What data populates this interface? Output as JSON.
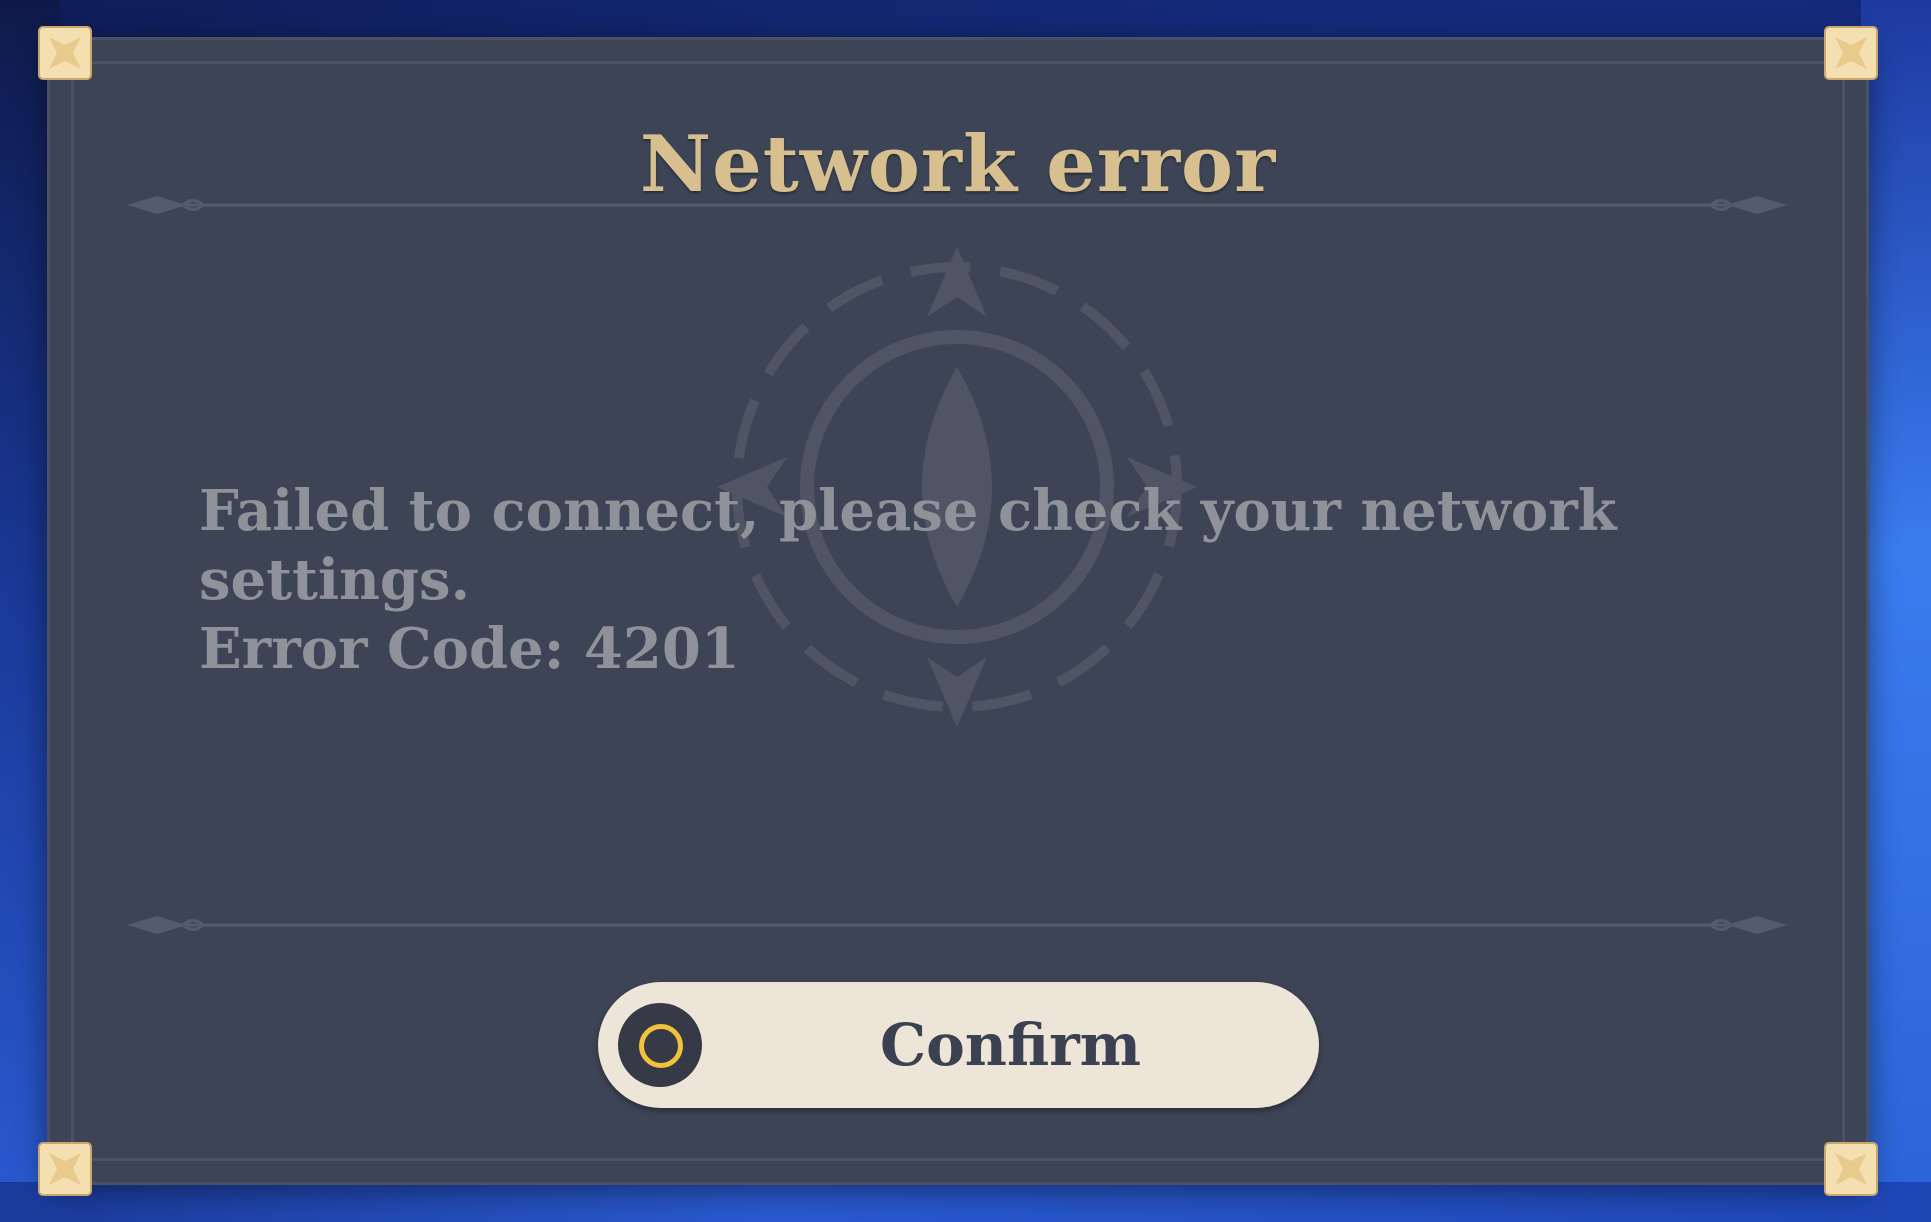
{
  "dialog": {
    "title": "Network error",
    "message_lines": [
      "Failed to connect, please check your network",
      "settings.",
      "Error Code: 4201"
    ],
    "confirm_label": "Confirm",
    "confirm_icon": "circle-button-icon"
  },
  "colors": {
    "panel": "#3d4455",
    "title": "#d7bf8f",
    "message": "#8f9299",
    "button_bg": "#ece5d8",
    "button_text": "#3b4150",
    "icon_ring": "#f2c23a",
    "corner_ornament": "#f3dfb0"
  }
}
